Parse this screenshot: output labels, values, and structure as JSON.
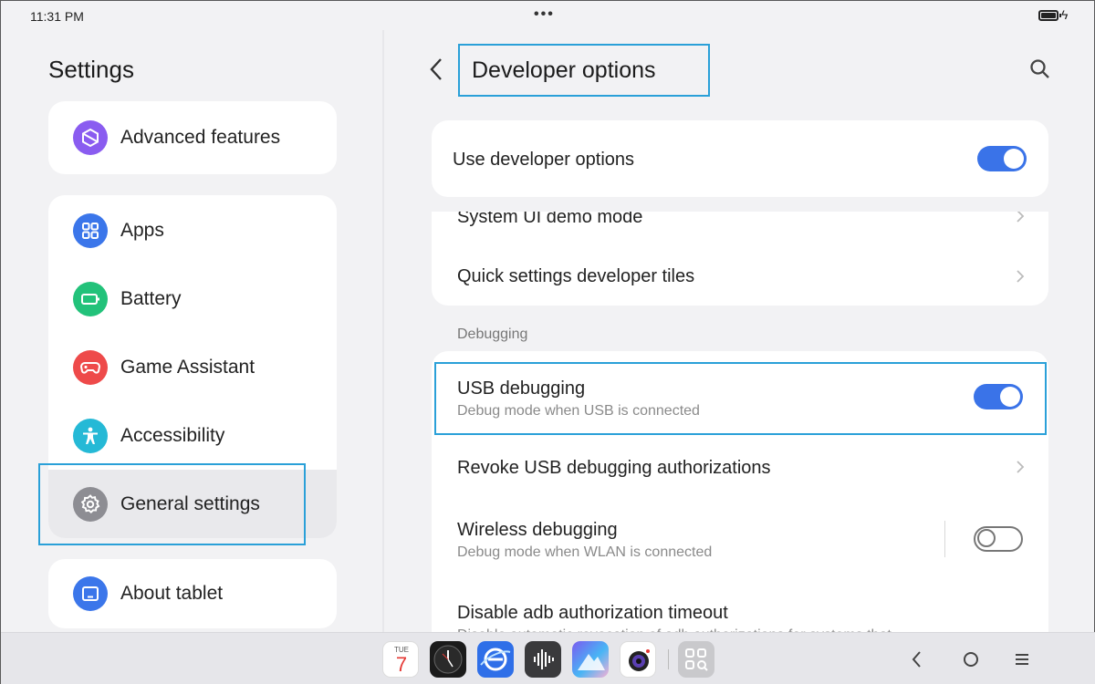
{
  "status": {
    "time": "11:31 PM",
    "dots": "•••"
  },
  "left": {
    "title": "Settings",
    "items": [
      {
        "label": "Advanced features",
        "icon": "hexagon-icon",
        "color": "#8a5cf0"
      },
      {
        "label": "Apps",
        "icon": "grid-icon",
        "color": "#3b76ea"
      },
      {
        "label": "Battery",
        "icon": "battery-icon",
        "color": "#22c27a"
      },
      {
        "label": "Game Assistant",
        "icon": "gamepad-icon",
        "color": "#ee4a4a"
      },
      {
        "label": "Accessibility",
        "icon": "accessibility-icon",
        "color": "#25b9d6"
      },
      {
        "label": "General settings",
        "icon": "gear-icon",
        "color": "#8d8d93"
      },
      {
        "label": "About tablet",
        "icon": "tablet-icon",
        "color": "#3b76ea"
      }
    ]
  },
  "right": {
    "title": "Developer options",
    "use_dev": {
      "label": "Use developer options",
      "state": "on"
    },
    "rows_top": [
      {
        "label": "System UI demo mode"
      },
      {
        "label": "Quick settings developer tiles"
      }
    ],
    "section": "Debugging",
    "usb": {
      "label": "USB debugging",
      "sub": "Debug mode when USB is connected",
      "state": "on"
    },
    "revoke": {
      "label": "Revoke USB debugging authorizations"
    },
    "wireless": {
      "label": "Wireless debugging",
      "sub": "Debug mode when WLAN is connected",
      "state": "off"
    },
    "adb": {
      "label": "Disable adb authorization timeout",
      "sub": "Disable automatic revocation of adb authorizations for systems that"
    }
  },
  "dock": {
    "calendar": {
      "day": "TUE",
      "date": "7"
    }
  },
  "colors": {
    "accent": "#3a73e8",
    "highlight": "#2aa0d8"
  }
}
